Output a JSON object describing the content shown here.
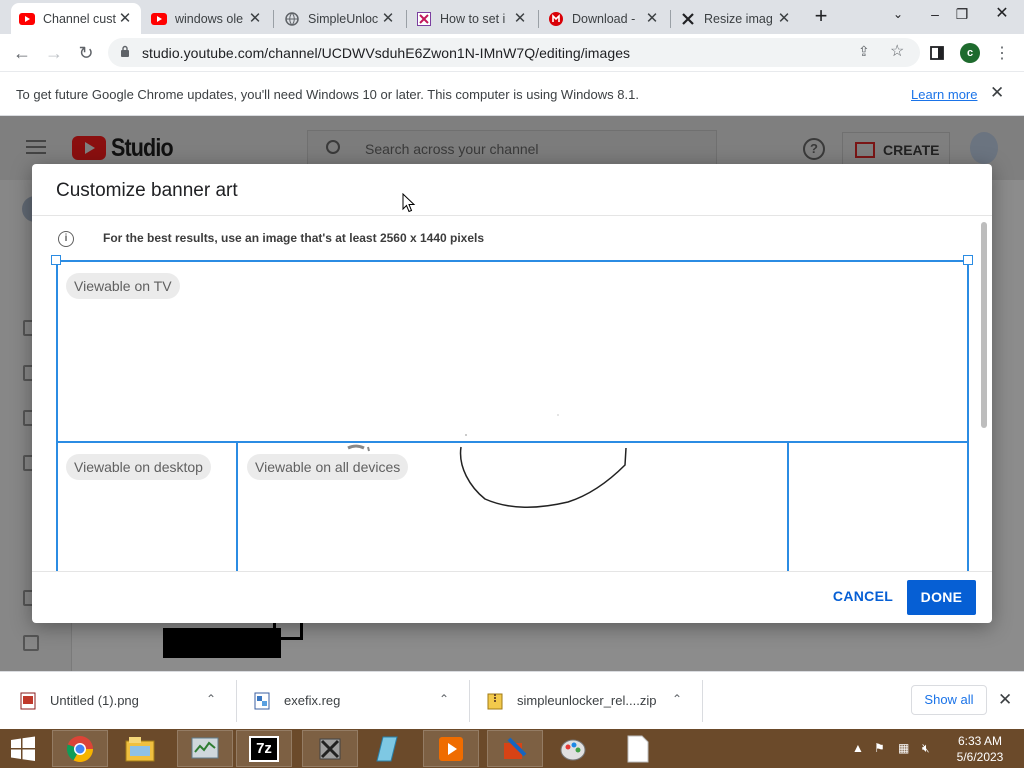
{
  "browser": {
    "tabs": [
      {
        "title": "Channel cust",
        "icon": "youtube-icon",
        "active": true
      },
      {
        "title": "windows ole",
        "icon": "youtube-icon",
        "active": false
      },
      {
        "title": "SimpleUnloc",
        "icon": "globe-icon",
        "active": false
      },
      {
        "title": "How to set i",
        "icon": "cross-stitch-icon",
        "active": false
      },
      {
        "title": "Download -",
        "icon": "mega-icon",
        "active": false
      },
      {
        "title": "Resize imag",
        "icon": "tools-icon",
        "active": false
      }
    ],
    "url": "studio.youtube.com/channel/UCDWVsduhE6Zwon1N-IMnW7Q/editing/images",
    "profile_initial": "c"
  },
  "infobar": {
    "message": "To get future Google Chrome updates, you'll need Windows 10 or later. This computer is using Windows 8.1.",
    "link": "Learn more"
  },
  "studio": {
    "logo_text": "Studio",
    "search_placeholder": "Search across your channel",
    "create_label": "CREATE"
  },
  "dialog": {
    "title": "Customize banner art",
    "info": "For the best results, use an image that's at least 2560 x 1440 pixels",
    "regions": {
      "tv": "Viewable on TV",
      "desktop": "Viewable on desktop",
      "all_devices": "Viewable on all devices"
    },
    "cancel_label": "CANCEL",
    "done_label": "DONE"
  },
  "downloads": [
    {
      "name": "Untitled (1).png",
      "icon": "image-file-icon"
    },
    {
      "name": "exefix.reg",
      "icon": "registry-file-icon"
    },
    {
      "name": "simpleunlocker_rel....zip",
      "icon": "zip-file-icon"
    }
  ],
  "downloads_show_all": "Show all",
  "taskbar": {
    "time": "6:33 AM",
    "date": "5/6/2023"
  }
}
